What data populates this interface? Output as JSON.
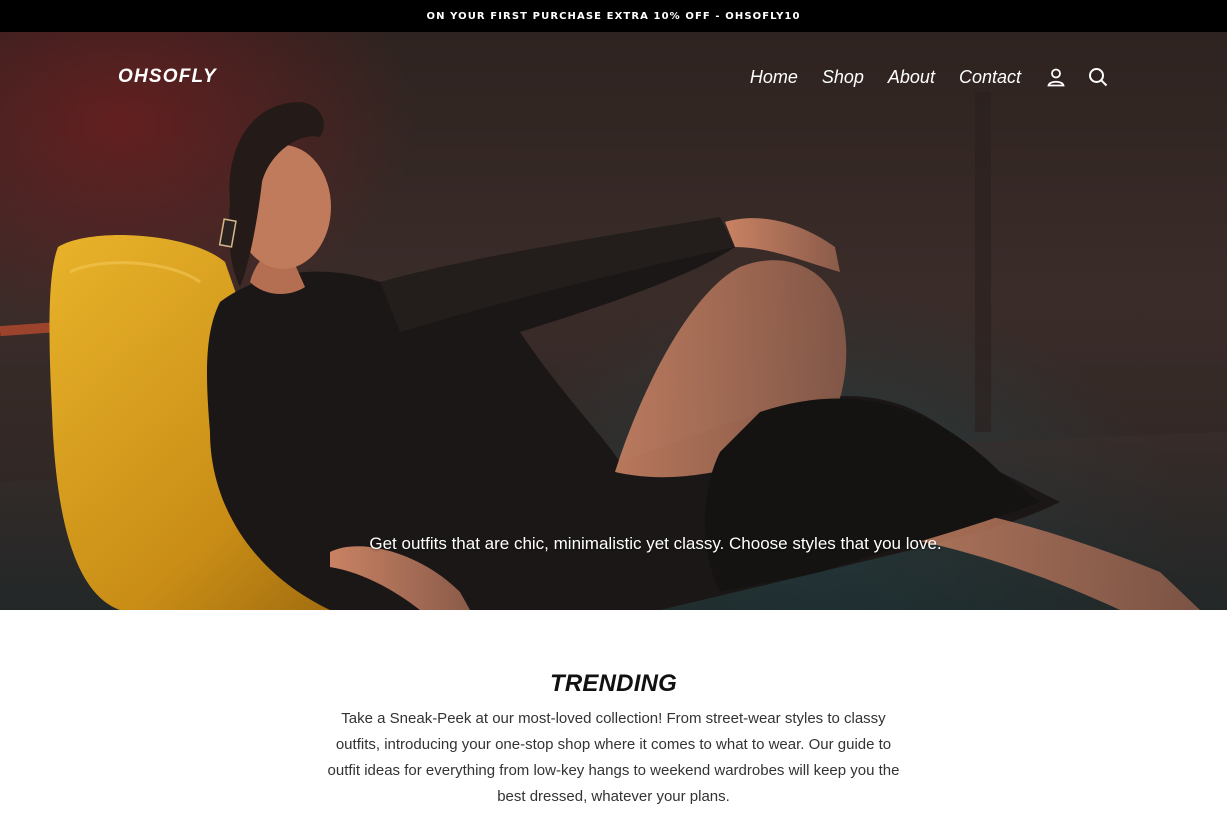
{
  "announcement": {
    "text": "ON YOUR FIRST PURCHASE EXTRA 10% OFF - OHSOFLY10"
  },
  "header": {
    "logo": "OHSOFLY",
    "nav": [
      {
        "label": "Home"
      },
      {
        "label": "Shop"
      },
      {
        "label": "About"
      },
      {
        "label": "Contact"
      }
    ],
    "icons": [
      "account-icon",
      "search-icon"
    ]
  },
  "hero": {
    "caption": "Get outfits that are chic, minimalistic yet classy. Choose styles that you love."
  },
  "trending": {
    "title": "TRENDING",
    "body": "Take a Sneak-Peek at our most-loved collection! From street-wear styles to classy outfits, introducing your one-stop shop where it comes to what to wear. Our guide to outfit ideas for everything from low-key hangs to weekend wardrobes will keep you the best dressed, whatever your plans."
  },
  "colors": {
    "announcement_bg": "#000000",
    "chair": "#d9a21e",
    "hero_dark": "#2e2320",
    "text": "#111111"
  }
}
